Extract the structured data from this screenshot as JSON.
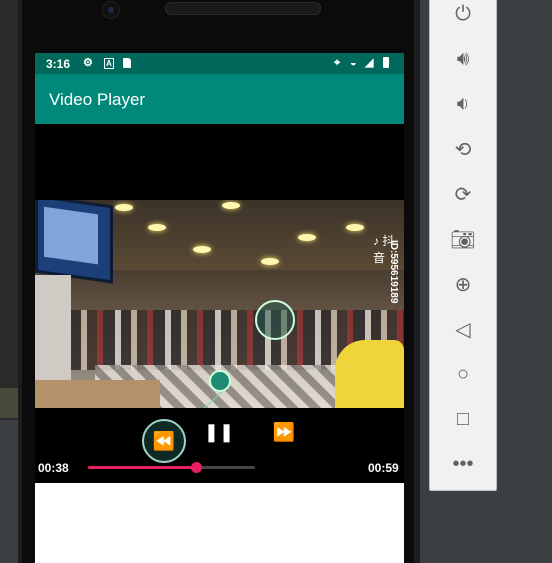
{
  "status_bar": {
    "time": "3:16",
    "left_icons": [
      "settings-icon",
      "a-icon",
      "sdcard-icon"
    ],
    "right_icons": [
      "location-icon",
      "wifi-icon",
      "signal-icon",
      "battery-icon"
    ]
  },
  "app_bar": {
    "title": "Video Player"
  },
  "video": {
    "watermark_logo": "♪ 抖音",
    "watermark_id": "ID:595619189"
  },
  "player": {
    "current_time": "00:38",
    "duration": "00:59",
    "progress": 0.644,
    "rewind_icon": "rewind-icon",
    "pause_icon": "pause-icon",
    "forward_icon": "fast-forward-icon"
  },
  "emulator_panel": {
    "buttons": [
      "power-icon",
      "volume-up-icon",
      "volume-down-icon",
      "rotate-left-icon",
      "rotate-right-icon",
      "camera-icon",
      "zoom-icon",
      "back-icon",
      "home-icon",
      "overview-icon",
      "more-icon"
    ]
  },
  "colors": {
    "status": "#00695c",
    "appbar": "#00897b",
    "seek": "#e91e63"
  }
}
